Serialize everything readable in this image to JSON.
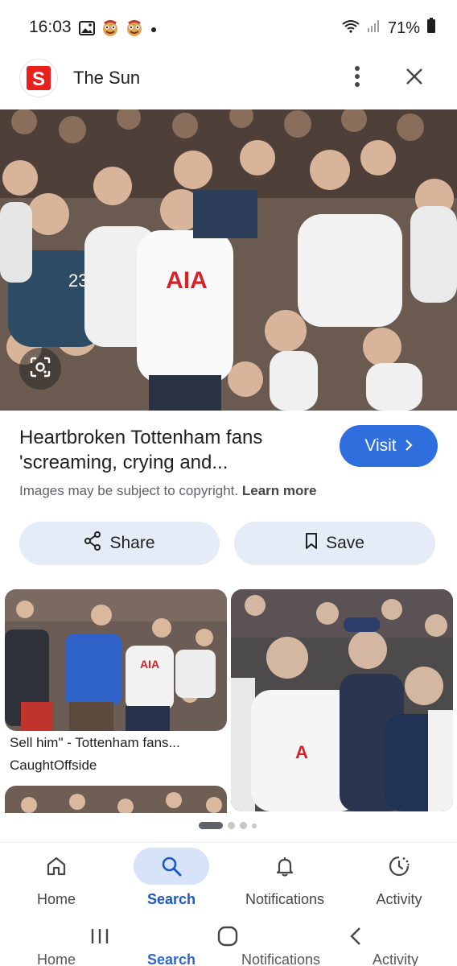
{
  "status_bar": {
    "time": "16:03",
    "battery": "71%",
    "icons_left": [
      "gallery-icon",
      "emoji-icon",
      "emoji-icon",
      "dot-icon"
    ],
    "icons_right": [
      "wifi-icon",
      "signal-icon",
      "battery-icon"
    ]
  },
  "header": {
    "source_name": "The Sun",
    "logo_letter": "S",
    "logo_color": "#e8211d"
  },
  "result": {
    "title": "Heartbroken Tottenham fans 'screaming, crying and...",
    "visit_label": "Visit",
    "copyright_text": "Images may be subject to copyright.",
    "learn_more": "Learn more"
  },
  "actions": {
    "share_label": "Share",
    "save_label": "Save"
  },
  "related": {
    "card1_caption": "Sell him\" - Tottenham fans...",
    "card1_source": "CaughtOffside"
  },
  "bottom_nav": {
    "items": [
      {
        "label": "Home",
        "icon": "home-icon"
      },
      {
        "label": "Search",
        "icon": "search-icon"
      },
      {
        "label": "Notifications",
        "icon": "bell-icon"
      },
      {
        "label": "Activity",
        "icon": "activity-icon"
      }
    ],
    "active": "Search"
  },
  "colors": {
    "accent": "#2f6fdd",
    "action_bg": "#e5ecf8",
    "active_nav_bg": "#d7e3f8",
    "active_nav_text": "#1a57c9"
  }
}
